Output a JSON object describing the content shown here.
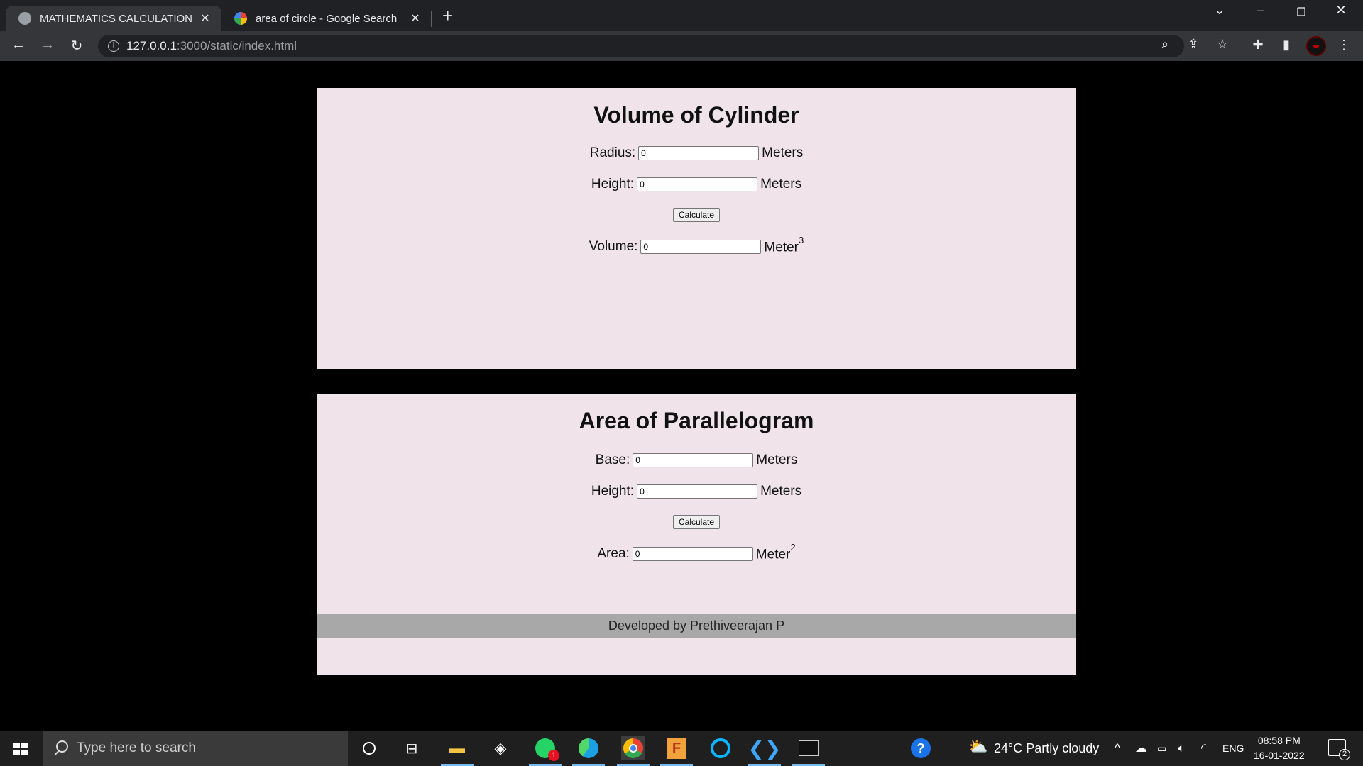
{
  "browser": {
    "tabs": [
      {
        "title": "MATHEMATICS CALCULATION BY",
        "active": true
      },
      {
        "title": "area of circle - Google Search",
        "active": false
      }
    ],
    "url_host": "127.0.0.1",
    "url_rest": ":3000/static/index.html"
  },
  "cylinder": {
    "title": "Volume of Cylinder",
    "radius_label": "Radius:",
    "radius_value": "0",
    "radius_unit": "Meters",
    "height_label": "Height:",
    "height_value": "0",
    "height_unit": "Meters",
    "button": "Calculate",
    "result_label": "Volume:",
    "result_value": "0",
    "result_unit": "Meter",
    "result_exp": "3"
  },
  "parallelogram": {
    "title": "Area of Parallelogram",
    "base_label": "Base:",
    "base_value": "0",
    "base_unit": "Meters",
    "height_label": "Height:",
    "height_value": "0",
    "height_unit": "Meters",
    "button": "Calculate",
    "result_label": "Area:",
    "result_value": "0",
    "result_unit": "Meter",
    "result_exp": "2"
  },
  "footer": "Developed by Prethiveerajan P",
  "taskbar": {
    "search_placeholder": "Type here to search",
    "whatsapp_badge": "1",
    "weather": "24°C  Partly cloudy",
    "language": "ENG",
    "time": "08:58 PM",
    "date": "16-01-2022",
    "notifications": "2"
  },
  "colors": {
    "card_bg": "#f0e4ea",
    "footer_bg": "#a8a8a8",
    "chrome_dark": "#202124"
  }
}
